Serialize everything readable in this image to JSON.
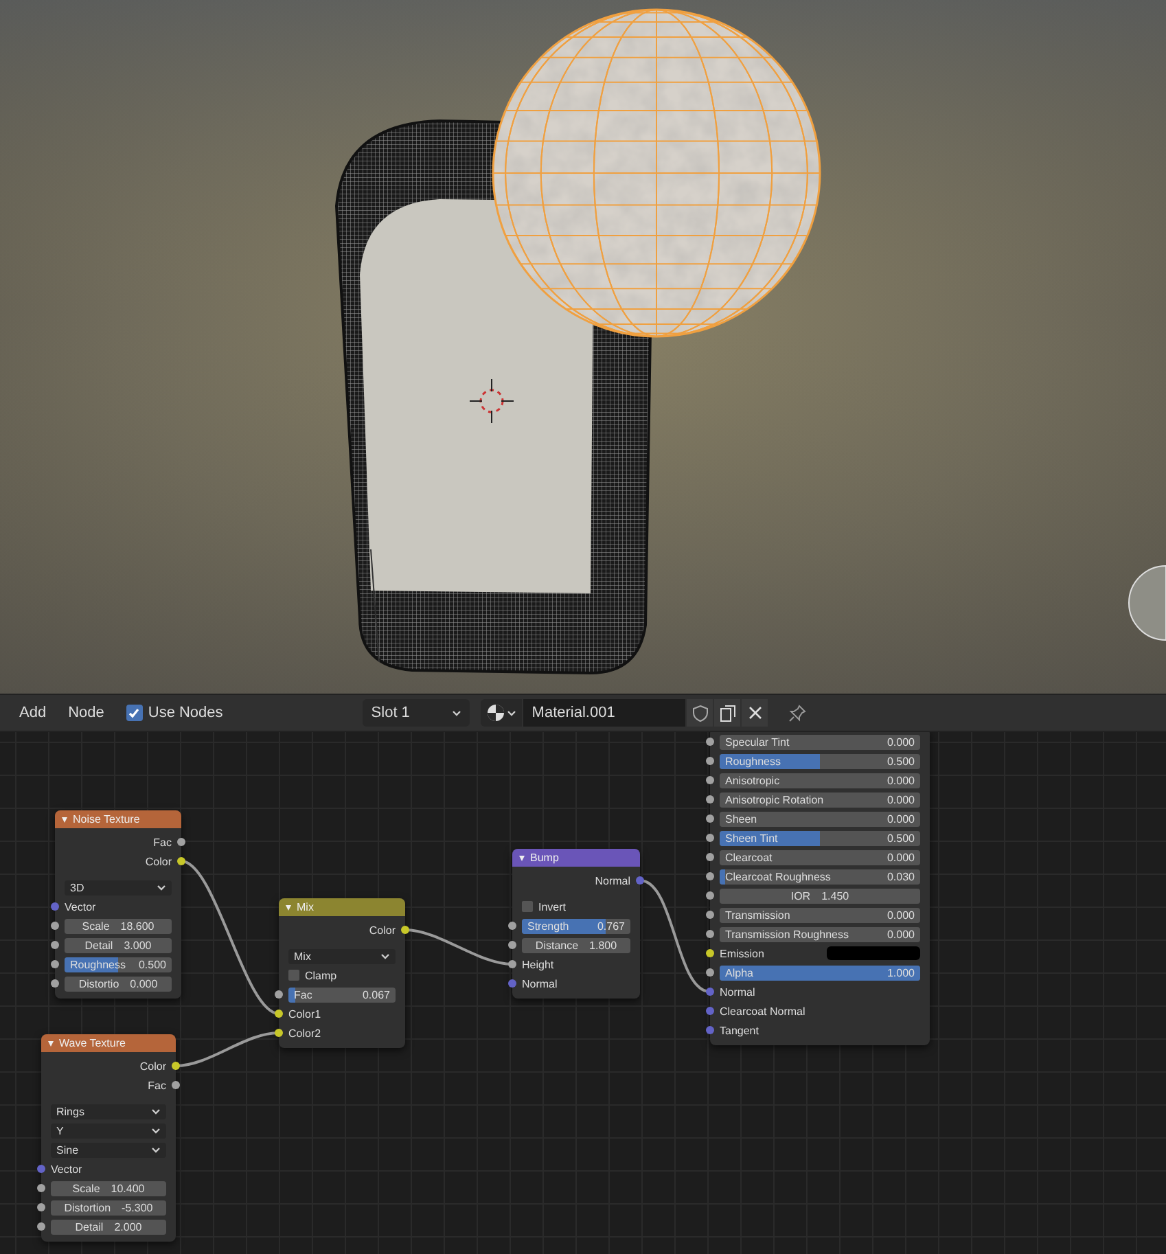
{
  "header": {
    "menus": [
      "Add",
      "Node"
    ],
    "use_nodes": {
      "label": "Use Nodes",
      "checked": true
    },
    "slot": "Slot 1",
    "material": "Material.001"
  },
  "nodes": [
    {
      "rows": [
        {
          "kind": "slider",
          "label": "Specular Tint",
          "value": "0.000",
          "level": 0,
          "socket": {
            "color": "#a1a1a1"
          }
        },
        {
          "kind": "slider",
          "label": "Roughness",
          "value": "0.500",
          "level": 0.5,
          "socket": {
            "color": "#a1a1a1"
          }
        },
        {
          "kind": "slider",
          "label": "Anisotropic",
          "value": "0.000",
          "level": 0,
          "socket": {
            "color": "#a1a1a1"
          }
        },
        {
          "kind": "slider",
          "label": "Anisotropic Rotation",
          "value": "0.000",
          "level": 0,
          "socket": {
            "color": "#a1a1a1"
          }
        },
        {
          "kind": "slider",
          "label": "Sheen",
          "value": "0.000",
          "level": 0,
          "socket": {
            "color": "#a1a1a1"
          }
        },
        {
          "kind": "slider",
          "label": "Sheen Tint",
          "value": "0.500",
          "level": 0.5,
          "socket": {
            "color": "#a1a1a1"
          }
        },
        {
          "kind": "slider",
          "label": "Clearcoat",
          "value": "0.000",
          "level": 0,
          "socket": {
            "color": "#a1a1a1"
          }
        },
        {
          "kind": "slider",
          "label": "Clearcoat Roughness",
          "value": "0.030",
          "level": 0.03,
          "socket": {
            "color": "#a1a1a1"
          }
        },
        {
          "kind": "number",
          "label": "IOR",
          "value": "1.450",
          "socket": {
            "color": "#a1a1a1"
          }
        },
        {
          "kind": "slider",
          "label": "Transmission",
          "value": "0.000",
          "level": 0,
          "socket": {
            "color": "#a1a1a1"
          }
        },
        {
          "kind": "slider",
          "label": "Transmission Roughness",
          "value": "0.000",
          "level": 0,
          "socket": {
            "color": "#a1a1a1"
          }
        },
        {
          "kind": "color",
          "label": "Emission",
          "color": "#000000",
          "socket": {
            "color": "#c7c729"
          }
        },
        {
          "kind": "slider",
          "label": "Alpha",
          "value": "1.000",
          "level": 1,
          "socket": {
            "color": "#a1a1a1"
          }
        },
        {
          "kind": "input",
          "label": "Normal",
          "socket": {
            "color": "#6363c7"
          }
        },
        {
          "kind": "input",
          "label": "Clearcoat Normal",
          "socket": {
            "color": "#6363c7"
          }
        },
        {
          "kind": "input",
          "label": "Tangent",
          "socket": {
            "color": "#6363c7"
          }
        }
      ]
    },
    {
      "title": "Noise Texture",
      "color": "#b5653a",
      "rows": [
        {
          "kind": "output",
          "label": "Fac",
          "socket": {
            "color": "#a1a1a1"
          }
        },
        {
          "kind": "output",
          "label": "Color",
          "socket": {
            "color": "#c7c729"
          }
        },
        {
          "kind": "dropdown",
          "value": "3D"
        },
        {
          "kind": "input",
          "label": "Vector",
          "socket": {
            "color": "#6363c7"
          }
        },
        {
          "kind": "number",
          "label": "Scale",
          "value": "18.600",
          "socket": {
            "color": "#a1a1a1"
          }
        },
        {
          "kind": "number",
          "label": "Detail",
          "value": "3.000",
          "socket": {
            "color": "#a1a1a1"
          }
        },
        {
          "kind": "slider",
          "label": "Roughness",
          "value": "0.500",
          "level": 0.5,
          "socket": {
            "color": "#a1a1a1"
          }
        },
        {
          "kind": "number",
          "label": "Distortio",
          "value": "0.000",
          "socket": {
            "color": "#a1a1a1"
          }
        }
      ]
    },
    {
      "title": "Bump",
      "color": "#6a55b8",
      "rows": [
        {
          "kind": "output",
          "label": "Normal",
          "socket": {
            "color": "#6363c7"
          }
        },
        {
          "kind": "checkbox",
          "label": "Invert",
          "checked": false
        },
        {
          "kind": "slider",
          "label": "Strength",
          "value": "0.767",
          "level": 0.767,
          "socket": {
            "color": "#a1a1a1"
          }
        },
        {
          "kind": "number",
          "label": "Distance",
          "value": "1.800",
          "socket": {
            "color": "#a1a1a1"
          }
        },
        {
          "kind": "input",
          "label": "Height",
          "socket": {
            "color": "#a1a1a1"
          }
        },
        {
          "kind": "input",
          "label": "Normal",
          "socket": {
            "color": "#6363c7"
          }
        }
      ]
    },
    {
      "title": "Mix",
      "color": "#8c8530",
      "rows": [
        {
          "kind": "output",
          "label": "Color",
          "socket": {
            "color": "#c7c729"
          }
        },
        {
          "kind": "dropdown",
          "value": "Mix"
        },
        {
          "kind": "checkbox",
          "label": "Clamp",
          "checked": false
        },
        {
          "kind": "slider",
          "label": "Fac",
          "value": "0.067",
          "level": 0.067,
          "socket": {
            "color": "#a1a1a1"
          }
        },
        {
          "kind": "input",
          "label": "Color1",
          "socket": {
            "color": "#c7c729"
          }
        },
        {
          "kind": "input",
          "label": "Color2",
          "socket": {
            "color": "#c7c729"
          }
        }
      ]
    },
    {
      "title": "Wave Texture",
      "color": "#b5653a",
      "rows": [
        {
          "kind": "output",
          "label": "Color",
          "socket": {
            "color": "#c7c729"
          }
        },
        {
          "kind": "output",
          "label": "Fac",
          "socket": {
            "color": "#a1a1a1"
          }
        },
        {
          "kind": "dropdown",
          "value": "Rings"
        },
        {
          "kind": "dropdown",
          "value": "Y"
        },
        {
          "kind": "dropdown",
          "value": "Sine"
        },
        {
          "kind": "input",
          "label": "Vector",
          "socket": {
            "color": "#6363c7"
          }
        },
        {
          "kind": "number",
          "label": "Scale",
          "value": "10.400",
          "socket": {
            "color": "#a1a1a1"
          }
        },
        {
          "kind": "number",
          "label": "Distortion",
          "value": "-5.300",
          "socket": {
            "color": "#a1a1a1"
          }
        },
        {
          "kind": "number",
          "label": "Detail",
          "value": "2.000",
          "socket": {
            "color": "#a1a1a1"
          }
        }
      ]
    }
  ]
}
